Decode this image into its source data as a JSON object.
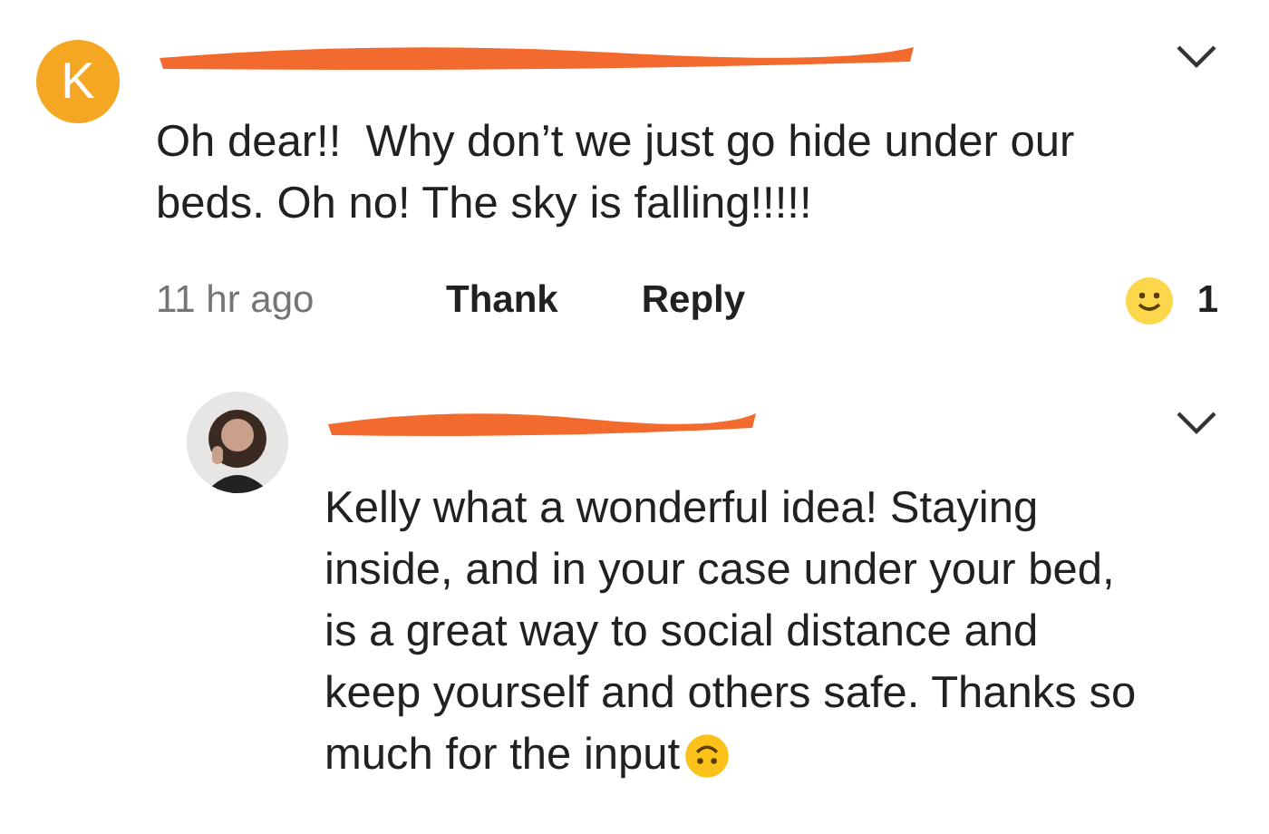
{
  "comment": {
    "avatar_letter": "K",
    "text": "Oh dear!!  Why don’t we just go hide under our beds. Oh no! The sky is falling!!!!!",
    "time": "11 hr ago",
    "actions": [
      "Thank",
      "Reply"
    ],
    "reaction_count": "1"
  },
  "reply": {
    "text_parts": [
      "Kelly what a wonderful idea! Staying inside, and in your case under your bed, is a great way to social distance and keep yourself and others safe. Thanks so",
      "much for the input"
    ]
  }
}
